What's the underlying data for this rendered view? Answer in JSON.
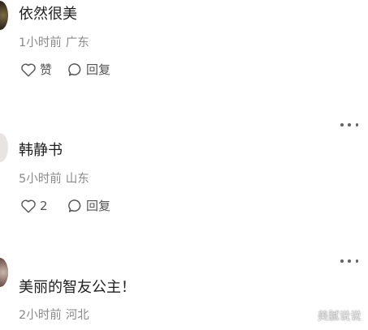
{
  "comments": [
    {
      "name": "依然很美",
      "time": "1小时前",
      "location": "广东",
      "like_label": "赞",
      "reply_label": "回复",
      "avatar_tone": "dark"
    },
    {
      "name": "韩静书",
      "time": "5小时前",
      "location": "山东",
      "like_label": "2",
      "reply_label": "回复",
      "avatar_tone": "light"
    },
    {
      "name": "美丽的智友公主！",
      "time": "2小时前",
      "location": "河北",
      "avatar_tone": "brown"
    }
  ],
  "icons": {
    "like": "heart-outline-icon",
    "reply": "speech-bubble-icon",
    "more": "ellipsis-icon"
  },
  "colors": {
    "text": "#1e1e1e",
    "meta": "#8a8a8a",
    "action": "#555555"
  },
  "watermark": "美腻说说"
}
